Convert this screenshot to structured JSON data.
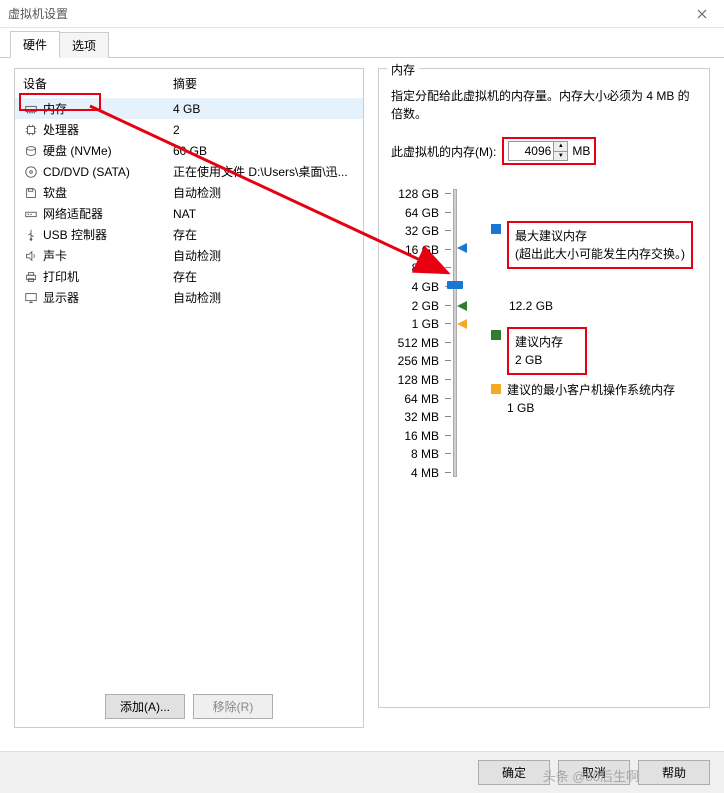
{
  "window": {
    "title": "虚拟机设置"
  },
  "tabs": {
    "hardware": "硬件",
    "options": "选项"
  },
  "columns": {
    "device": "设备",
    "summary": "摘要"
  },
  "devices": [
    {
      "icon": "memory",
      "name": "内存",
      "summary": "4 GB",
      "selected": true
    },
    {
      "icon": "cpu",
      "name": "处理器",
      "summary": "2"
    },
    {
      "icon": "disk",
      "name": "硬盘 (NVMe)",
      "summary": "60 GB"
    },
    {
      "icon": "disc",
      "name": "CD/DVD (SATA)",
      "summary": "正在使用文件 D:\\Users\\桌面\\迅..."
    },
    {
      "icon": "floppy",
      "name": "软盘",
      "summary": "自动检测"
    },
    {
      "icon": "net",
      "name": "网络适配器",
      "summary": "NAT"
    },
    {
      "icon": "usb",
      "name": "USB 控制器",
      "summary": "存在"
    },
    {
      "icon": "sound",
      "name": "声卡",
      "summary": "自动检测"
    },
    {
      "icon": "printer",
      "name": "打印机",
      "summary": "存在"
    },
    {
      "icon": "display",
      "name": "显示器",
      "summary": "自动检测"
    }
  ],
  "leftButtons": {
    "add": "添加(A)...",
    "remove": "移除(R)"
  },
  "memoryPanel": {
    "legend": "内存",
    "desc": "指定分配给此虚拟机的内存量。内存大小必须为 4 MB 的倍数。",
    "label": "此虚拟机的内存(M):",
    "value": "4096",
    "unit": "MB",
    "ticks": [
      "128 GB",
      "64 GB",
      "32 GB",
      "16 GB",
      "8 GB",
      "4 GB",
      "2 GB",
      "1 GB",
      "512 MB",
      "256 MB",
      "128 MB",
      "64 MB",
      "32 MB",
      "16 MB",
      "8 MB",
      "4 MB"
    ],
    "legends": {
      "max": {
        "title": "最大建议内存",
        "note": "(超出此大小可能发生内存交换。)",
        "value": "12.2 GB"
      },
      "rec": {
        "title": "建议内存",
        "value": "2 GB"
      },
      "min": {
        "title": "建议的最小客户机操作系统内存",
        "value": "1 GB"
      }
    }
  },
  "footer": {
    "ok": "确定",
    "cancel": "取消",
    "help": "帮助"
  },
  "watermark": "头条 @80后生啊"
}
